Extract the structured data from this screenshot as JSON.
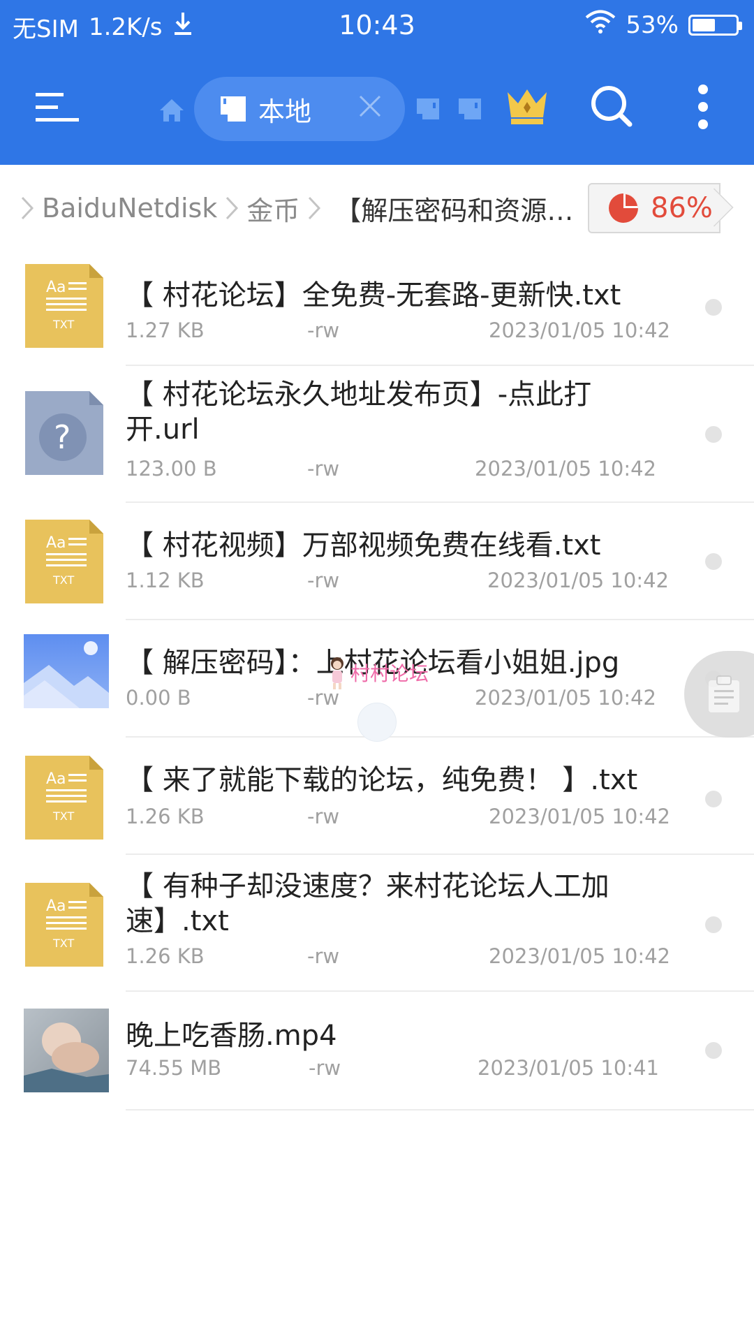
{
  "status_bar": {
    "carrier": "无SIM",
    "speed": "1.2K/s",
    "time": "10:43",
    "battery": "53%",
    "battery_level": 0.53
  },
  "toolbar": {
    "tab_label": "本地"
  },
  "breadcrumb": {
    "items": [
      "BaiduNetdisk",
      "金币",
      "【解压密码和资源…"
    ],
    "usage": "86%",
    "usage_level": 0.86
  },
  "files": [
    {
      "name": "【 村花论坛】全免费-无套路-更新快.txt",
      "size": "1.27 KB",
      "perm": "-rw",
      "date": "2023/01/05 10:42",
      "icon": "txt-file-icon"
    },
    {
      "name": "【 村花论坛永久地址发布页】-点此打开.url",
      "size": "123.00 B",
      "perm": "-rw",
      "date": "2023/01/05 10:42",
      "icon": "unknown-file-icon"
    },
    {
      "name": "【 村花视频】万部视频免费在线看.txt",
      "size": "1.12 KB",
      "perm": "-rw",
      "date": "2023/01/05 10:42",
      "icon": "txt-file-icon"
    },
    {
      "name": "【 解压密码】：上村花论坛看小姐姐.jpg",
      "size": "0.00 B",
      "perm": "-rw",
      "date": "2023/01/05 10:42",
      "icon": "image-file-icon"
    },
    {
      "name": "【 来了就能下载的论坛，纯免费！ 】.txt",
      "size": "1.26 KB",
      "perm": "-rw",
      "date": "2023/01/05 10:42",
      "icon": "txt-file-icon"
    },
    {
      "name": "【 有种子却没速度？来村花论坛人工加速】.txt",
      "size": "1.26 KB",
      "perm": "-rw",
      "date": "2023/01/05 10:42",
      "icon": "txt-file-icon"
    },
    {
      "name": "晚上吃香肠.mp4",
      "size": "74.55 MB",
      "perm": "-rw",
      "date": "2023/01/05 10:41",
      "icon": "video-thumbnail"
    }
  ],
  "watermark": "村村论坛",
  "colors": {
    "header_blue": "#2f76e6",
    "txt_icon": "#e8c25c",
    "unknown_icon": "#9aaac7",
    "usage_red": "#e24b3b"
  }
}
